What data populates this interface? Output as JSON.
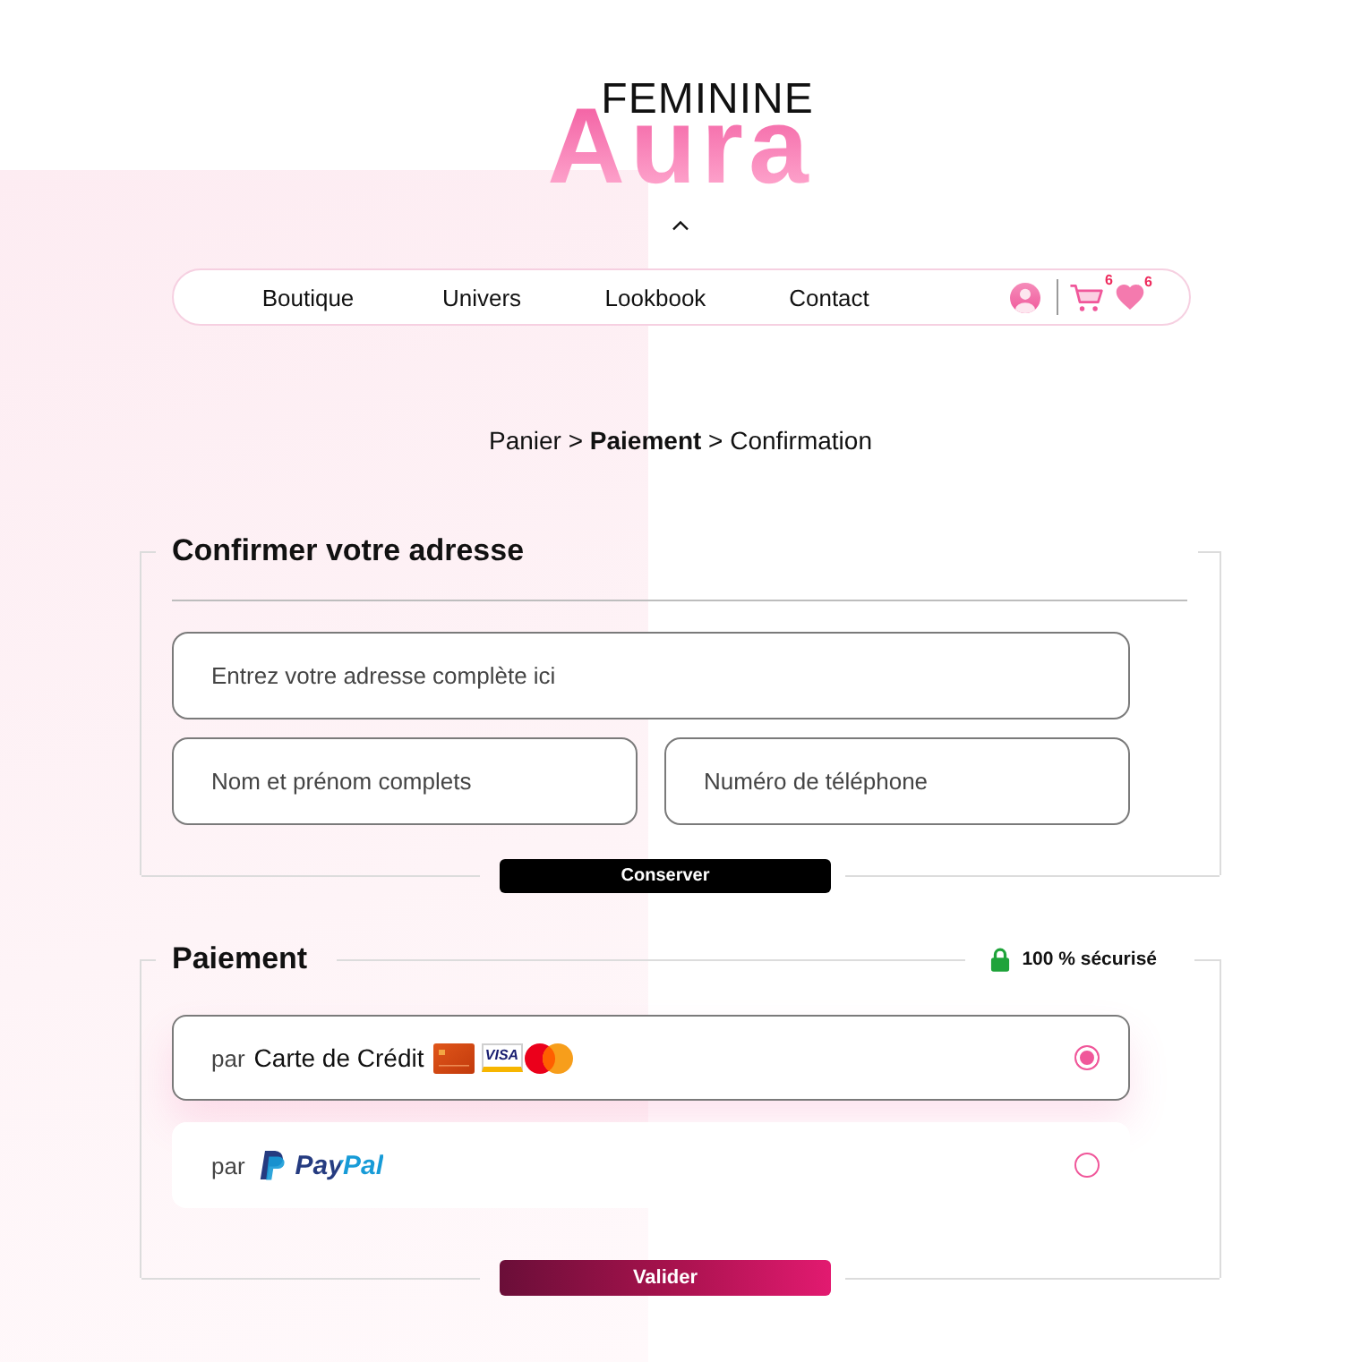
{
  "logo": {
    "small_text": "FEMININE",
    "large_text": "Aura"
  },
  "nav": {
    "links": [
      "Boutique",
      "Univers",
      "Lookbook",
      "Contact"
    ],
    "cart_count": "6",
    "wishlist_count": "6"
  },
  "breadcrumb": "Panier > **Paiement** > Confirmation",
  "address_section": {
    "title": "Confirmer votre adresse",
    "fields": [
      {
        "placeholder": "Entrez votre adresse complète ici"
      },
      {
        "placeholder": "Nom et prénom complets"
      },
      {
        "placeholder": "Numéro de téléphone"
      }
    ],
    "button": "Conserver"
  },
  "payment_section": {
    "title": "Paiement",
    "security_note": "100 % sécurisé",
    "methods": [
      {
        "kind": "card",
        "prefix": "par",
        "label": "Carte de Crédit",
        "selected": true,
        "brands": [
          {
            "kind": "chip-card"
          },
          {
            "kind": "visa",
            "label": "VISA"
          },
          {
            "kind": "mastercard"
          }
        ]
      },
      {
        "kind": "paypal",
        "prefix": "par",
        "label": "PayPal",
        "selected": false
      }
    ],
    "button": "Valider"
  }
}
